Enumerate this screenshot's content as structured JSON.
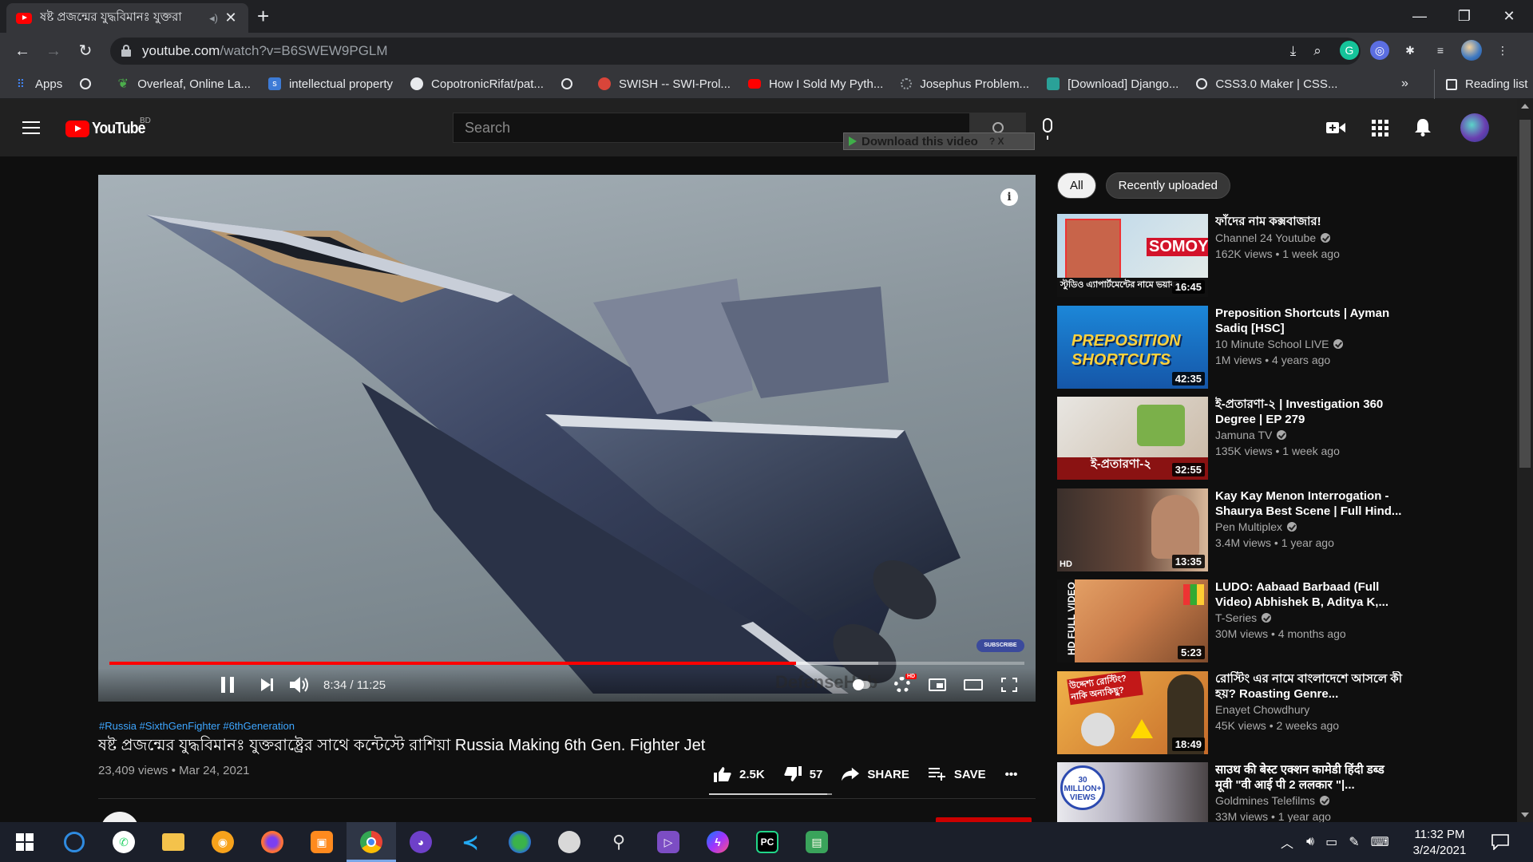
{
  "browser": {
    "tab_title": "ষষ্ট প্রজন্মের যুদ্ধবিমানঃ যুক্তরা",
    "url_host": "youtube.com",
    "url_path": "/watch?v=B6SWEW9PGLM",
    "bookmarks": [
      {
        "label": "Apps",
        "color": "#4285f4"
      },
      {
        "label": "",
        "color": "#e8eaed"
      },
      {
        "label": "Overleaf, Online La...",
        "color": "#4cae4c"
      },
      {
        "label": "intellectual property",
        "color": "#3d7bd6"
      },
      {
        "label": "CopotronicRifat/pat...",
        "color": "#e8eaed"
      },
      {
        "label": "",
        "color": "#e8eaed"
      },
      {
        "label": "SWISH -- SWI-Prol...",
        "color": "#d9453a"
      },
      {
        "label": "How I Sold My Pyth...",
        "color": "#ff0000"
      },
      {
        "label": "Josephus Problem...",
        "color": "#5f6368"
      },
      {
        "label": "[Download] Django...",
        "color": "#2aa198"
      },
      {
        "label": "CSS3.0 Maker | CSS...",
        "color": "#e8eaed"
      }
    ],
    "more_label": "»",
    "reading_list": "Reading list"
  },
  "youtube": {
    "logo_text": "YouTube",
    "country_code": "BD",
    "search_placeholder": "Search",
    "download_bar": "Download this video",
    "download_help": "? X"
  },
  "player": {
    "time": "8:34 / 11:25",
    "progress_played": 0.75,
    "progress_loaded": 0.84,
    "watermark": "DefenseHub",
    "subscribe_watermark": "SUBSCRIBE",
    "hd_badge": "HD"
  },
  "video": {
    "hashtags": "#Russia #SixthGenFighter #6thGeneration",
    "title": "ষষ্ট প্রজন্মের যুদ্ধবিমানঃ যুক্তরাষ্ট্রের সাথে কন্টেস্টে রাশিয়া Russia Making 6th Gen. Fighter Jet",
    "meta": "23,409 views • Mar 24, 2021",
    "likes": "2.5K",
    "dislikes": "57",
    "share": "SHARE",
    "save": "SAVE",
    "more": "•••"
  },
  "sidebar": {
    "chips": [
      "All",
      "Recently uploaded"
    ],
    "items": [
      {
        "title": "ফাঁদের নাম কক্সবাজার!",
        "channel": "Channel 24 Youtube",
        "verified": true,
        "meta": "162K views • 1 week ago",
        "duration": "16:45",
        "thumb_text": "স্টুডিও এ্যাপার্টমেন্টের নামে ভয়াবহ"
      },
      {
        "title": "Preposition Shortcuts | Ayman Sadiq [HSC]",
        "channel": "10 Minute School LIVE",
        "verified": true,
        "meta": "1M views • 4 years ago",
        "duration": "42:35",
        "thumb_text": "PREPOSITION SHORTCUTS"
      },
      {
        "title": "ই-প্রতারণা-২ | Investigation 360 Degree | EP 279",
        "channel": "Jamuna TV",
        "verified": true,
        "meta": "135K views • 1 week ago",
        "duration": "32:55",
        "thumb_text": "ই-প্রতারণা-২"
      },
      {
        "title": "Kay Kay Menon Interrogation - Shaurya Best Scene | Full Hind...",
        "channel": "Pen Multiplex",
        "verified": true,
        "meta": "3.4M views • 1 year ago",
        "duration": "13:35",
        "thumb_text": "HD"
      },
      {
        "title": "LUDO: Aabaad Barbaad (Full Video) Abhishek B, Aditya K,...",
        "channel": "T-Series",
        "verified": true,
        "meta": "30M views • 4 months ago",
        "duration": "5:23",
        "thumb_text": "HD FULL VIDEO"
      },
      {
        "title": "রোস্টিং এর নামে বাংলাদেশে আসলে কী হয়? Roasting Genre...",
        "channel": "Enayet Chowdhury",
        "verified": false,
        "meta": "45K views • 2 weeks ago",
        "duration": "18:49",
        "thumb_text": "উদ্দেশ্য রোস্টিং? নাকি অন্যকিছু?"
      },
      {
        "title": "साउथ की बेस्ट एक्शन कामेडी हिंदी डब्ड मूवी \"वी आई पी 2 ललकार \"|...",
        "channel": "Goldmines Telefilms",
        "verified": true,
        "meta": "33M views • 1 year ago",
        "duration": "",
        "thumb_text": "30 MILLION+ VIEWS"
      }
    ]
  },
  "taskbar": {
    "time": "11:32 PM",
    "date": "3/24/2021"
  }
}
